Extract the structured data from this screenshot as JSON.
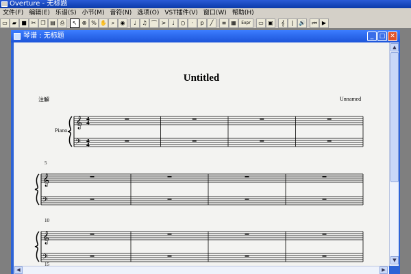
{
  "app": {
    "title": "Overture - 无标题"
  },
  "menu": [
    "文件(F)",
    "编辑(E)",
    "乐谱(S)",
    "小节(M)",
    "音符(N)",
    "选项(O)",
    "VST插件(V)",
    "窗口(W)",
    "帮助(H)"
  ],
  "toolbar": {
    "buttons": [
      {
        "name": "new-icon",
        "glyph": "▭"
      },
      {
        "name": "open-icon",
        "glyph": "▰"
      },
      {
        "name": "save-icon",
        "glyph": "■"
      },
      {
        "name": "cut-icon",
        "glyph": "✂"
      },
      {
        "name": "copy-icon",
        "glyph": "❐"
      },
      {
        "name": "paste-icon",
        "glyph": "▤"
      },
      {
        "name": "print-icon",
        "glyph": "⎙"
      },
      {
        "name": "select-arrow-icon",
        "glyph": "↖"
      },
      {
        "name": "erase-icon",
        "glyph": "⊗"
      },
      {
        "name": "percent-icon",
        "glyph": "%"
      },
      {
        "name": "hand-icon",
        "glyph": "✋"
      },
      {
        "name": "zoom-icon",
        "glyph": "⌕"
      },
      {
        "name": "color-icon",
        "glyph": "◉"
      },
      {
        "name": "quarter-note-icon",
        "glyph": "♩"
      },
      {
        "name": "eighth-notes-icon",
        "glyph": "♫"
      },
      {
        "name": "slur-icon",
        "glyph": "⌒"
      },
      {
        "name": "accent-icon",
        "glyph": ">"
      },
      {
        "name": "stem-note-icon",
        "glyph": "♩"
      },
      {
        "name": "whole-note-icon",
        "glyph": "○"
      },
      {
        "name": "dot-icon",
        "glyph": "·"
      },
      {
        "name": "dynamic-icon",
        "glyph": "p"
      },
      {
        "name": "tie-icon",
        "glyph": "╱"
      },
      {
        "name": "beams-icon",
        "glyph": "≡"
      },
      {
        "name": "grid-icon",
        "glyph": "▦"
      },
      {
        "name": "expression-icon",
        "glyph": "Expr"
      },
      {
        "name": "box-icon",
        "glyph": "▭"
      },
      {
        "name": "disk-icon",
        "glyph": "▣"
      },
      {
        "name": "treble-clef-icon",
        "glyph": "𝄞"
      },
      {
        "name": "barline-icon",
        "glyph": "|"
      },
      {
        "name": "speaker-icon",
        "glyph": "🔊"
      },
      {
        "name": "rewind-icon",
        "glyph": "⏮"
      },
      {
        "name": "play-icon",
        "glyph": "▶"
      }
    ]
  },
  "document": {
    "title": "琴谱 : 无标题"
  },
  "score": {
    "title": "Untitled",
    "annotation": "注解",
    "composer": "Unnamed",
    "instrument": "Piano",
    "time_top": "4",
    "time_bottom": "4",
    "systems": [
      {
        "number": ""
      },
      {
        "number": "5"
      },
      {
        "number": "10"
      },
      {
        "number": "15"
      }
    ]
  },
  "scroll": {
    "up": "▲",
    "down": "▼",
    "left": "◀",
    "right": "▶"
  }
}
